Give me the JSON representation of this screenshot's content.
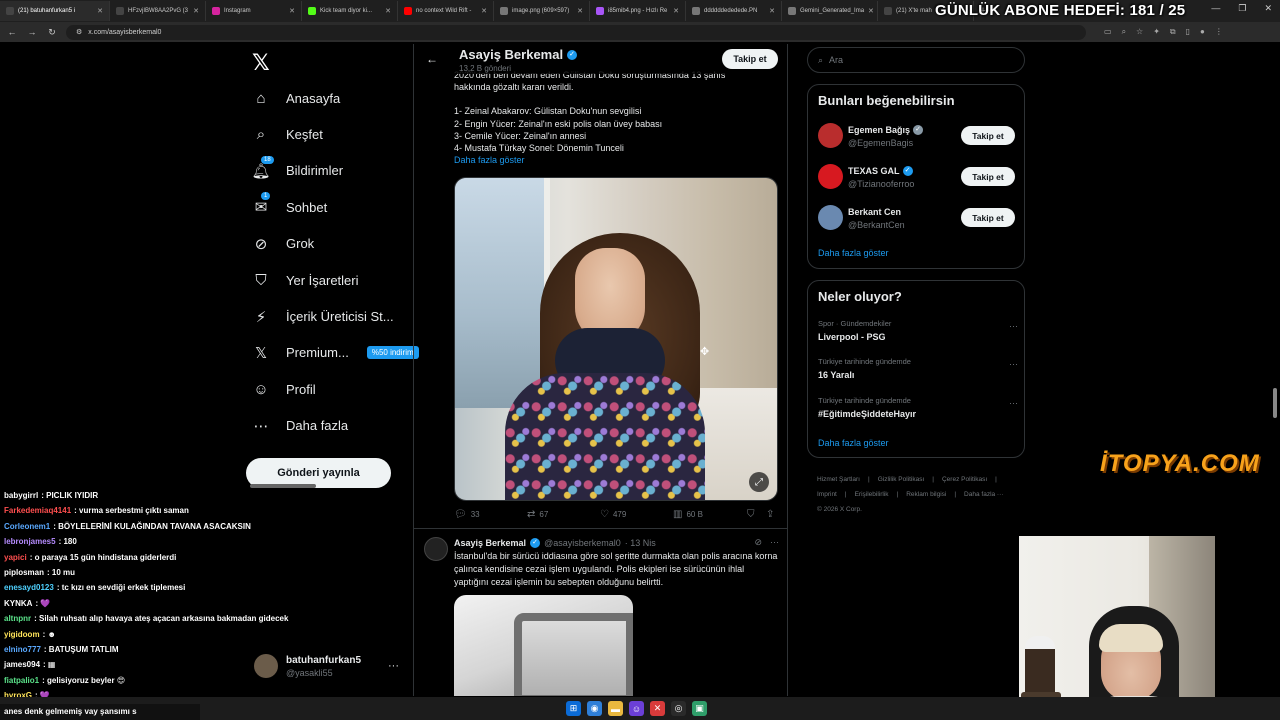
{
  "browser": {
    "tabs": [
      {
        "label": "(21) batuhanfurkan5 i",
        "color": "#444444"
      },
      {
        "label": "HFzvjIBW8AA2PvG (3",
        "color": "#444444"
      },
      {
        "label": "Instagram",
        "color": "#d6249f"
      },
      {
        "label": "Kick team diyor ki...",
        "color": "#53fc18"
      },
      {
        "label": "no context Wild Rift -",
        "color": "#ff0000"
      },
      {
        "label": "image.png (609×597)",
        "color": "#777777"
      },
      {
        "label": "i85mib4.png - Hızlı Re",
        "color": "#a855f7"
      },
      {
        "label": "ddddddededede.PN",
        "color": "#777777"
      },
      {
        "label": "Gemini_Generated_Ima",
        "color": "#777777"
      },
      {
        "label": "(21) X'te mah",
        "color": "#444444"
      }
    ],
    "url": "x.com/asayisberkemal0"
  },
  "overlay": {
    "abone_hedefi": "GÜNLÜK ABONE HEDEFİ: 181 / 25",
    "sponsor": "İTOPYA.COM"
  },
  "nav": {
    "items": [
      {
        "label": "Anasayfa",
        "icon": "⌂",
        "badge": ""
      },
      {
        "label": "Keşfet",
        "icon": "⌕",
        "badge": ""
      },
      {
        "label": "Bildirimler",
        "icon": "🔔︎",
        "badge": "18"
      },
      {
        "label": "Sohbet",
        "icon": "✉",
        "badge": "1"
      },
      {
        "label": "Grok",
        "icon": "⊘",
        "badge": ""
      },
      {
        "label": "Yer İşaretleri",
        "icon": "⛉",
        "badge": ""
      },
      {
        "label": "İçerik Üreticisi St...",
        "icon": "⚡",
        "badge": ""
      },
      {
        "label": "Premium...",
        "icon": "𝕏",
        "badge": ""
      },
      {
        "label": "Profil",
        "icon": "☺",
        "badge": ""
      },
      {
        "label": "Daha fazla",
        "icon": "⋯",
        "badge": ""
      }
    ],
    "premium_pill": "%50 indirim",
    "post_button": "Gönderi yayınla",
    "account_name": "batuhanfurkan5",
    "account_handle": "@yasakli55"
  },
  "profile": {
    "name": "Asayiş Berkemal",
    "post_count": "13,2 B gönderi",
    "follow_label": "Takip et"
  },
  "tweet1": {
    "lines": [
      "2020'den beri devam eden Gülistan Doku soruşturmasında 13 şahıs",
      "hakkında gözaltı kararı verildi.",
      "",
      "1- Zeinal Abakarov: Gülistan Doku'nun sevgilisi",
      "2- Engin Yücer: Zeinal'ın eski polis olan üvey babası",
      "3- Cemile Yücer: Zeinal'ın annesi",
      "4- Mustafa Türkay Sonel: Dönemin Tunceli"
    ],
    "show_more": "Daha fazla göster",
    "replies": "33",
    "retweets": "67",
    "likes": "479",
    "views": "60 B"
  },
  "tweet2": {
    "name": "Asayiş Berkemal",
    "handle": "@asayisberkemal0",
    "date": "· 13 Nis",
    "text": "İstanbul'da bir sürücü iddiasına göre sol şeritte durmakta olan polis aracına korna çalınca kendisine cezai işlem uygulandı. Polis ekipleri ise sürücünün ihlal yaptığını cezai işlemin bu sebepten olduğunu belirtti."
  },
  "sidebar": {
    "search_placeholder": "Ara",
    "who_title": "Bunları beğenebilirsin",
    "who": [
      {
        "name": "Egemen Bağış",
        "handle": "@EgemenBagis",
        "verified": "gray",
        "avatar_color": "#b92d2d"
      },
      {
        "name": "TEXAS GAL",
        "handle": "@Tizianooferroo",
        "verified": "blue",
        "avatar_color": "#d71920"
      },
      {
        "name": "Berkant Cen",
        "handle": "@BerkantCen",
        "verified": "",
        "avatar_color": "#6a89b0"
      }
    ],
    "follow_label": "Takip et",
    "who_more": "Daha fazla göster",
    "trends_title": "Neler oluyor?",
    "trends": [
      {
        "context": "Spor · Gündemdekiler",
        "title": "Liverpool - PSG"
      },
      {
        "context": "Türkiye tarihinde gündemde",
        "title": "16 Yaralı"
      },
      {
        "context": "Türkiye tarihinde gündemde",
        "title": "#EğitimdeŞiddeteHayır"
      }
    ],
    "trends_more": "Daha fazla göster",
    "footer": [
      "Hizmet Şartları",
      "|",
      "Gizlilik Politikası",
      "|",
      "Çerez Politikası",
      "|",
      "Imprint",
      "|",
      "Erişilebilirlik",
      "|",
      "Reklam bilgisi",
      "|",
      "Daha fazla ···",
      "© 2026 X Corp."
    ]
  },
  "chat": {
    "messages": [
      {
        "user": "babygirrl",
        "color": "#ffffff",
        "text": ": PICLIK IYIDIR"
      },
      {
        "user": "Farkedemiaq4141",
        "color": "#ff4f4f",
        "text": ": vurma serbestmi çıktı saman"
      },
      {
        "user": "Corleonem1",
        "color": "#5aa9ff",
        "text": ": BÖYLELERİNİ KULAĞINDAN TAVANA ASACAKSIN"
      },
      {
        "user": "lebronjames5",
        "color": "#b68cff",
        "text": ": 180"
      },
      {
        "user": "yapici",
        "color": "#ff4f4f",
        "text": ": o paraya 15 gün hindistana giderlerdi"
      },
      {
        "user": "piplosman",
        "color": "#ffffff",
        "text": ": 10 mu"
      },
      {
        "user": "enesayd0123",
        "color": "#4fd1ff",
        "text": ": tc kızı en sevdiği erkek tiplemesi"
      },
      {
        "user": "KYNKA",
        "color": "#ffffff",
        "text": ": 💜"
      },
      {
        "user": "altnpnr",
        "color": "#5be38a",
        "text": ": Silah ruhsatı alıp havaya ateş açacan arkasına bakmadan gidecek"
      },
      {
        "user": "yigidoom",
        "color": "#ffe45a",
        "text": ": ☻"
      },
      {
        "user": "elnino777",
        "color": "#5aa9ff",
        "text": ": BATUŞUM TATLIM"
      },
      {
        "user": "james094",
        "color": "#ffffff",
        "text": ": ▦"
      },
      {
        "user": "fiatpalio1",
        "color": "#5be38a",
        "text": ": gelisiyoruz beyler 😍"
      },
      {
        "user": "hyroxG",
        "color": "#ffe45a",
        "text": ": 💜"
      }
    ],
    "input_text": "anes denk gelmemiş vay şansımı s"
  }
}
